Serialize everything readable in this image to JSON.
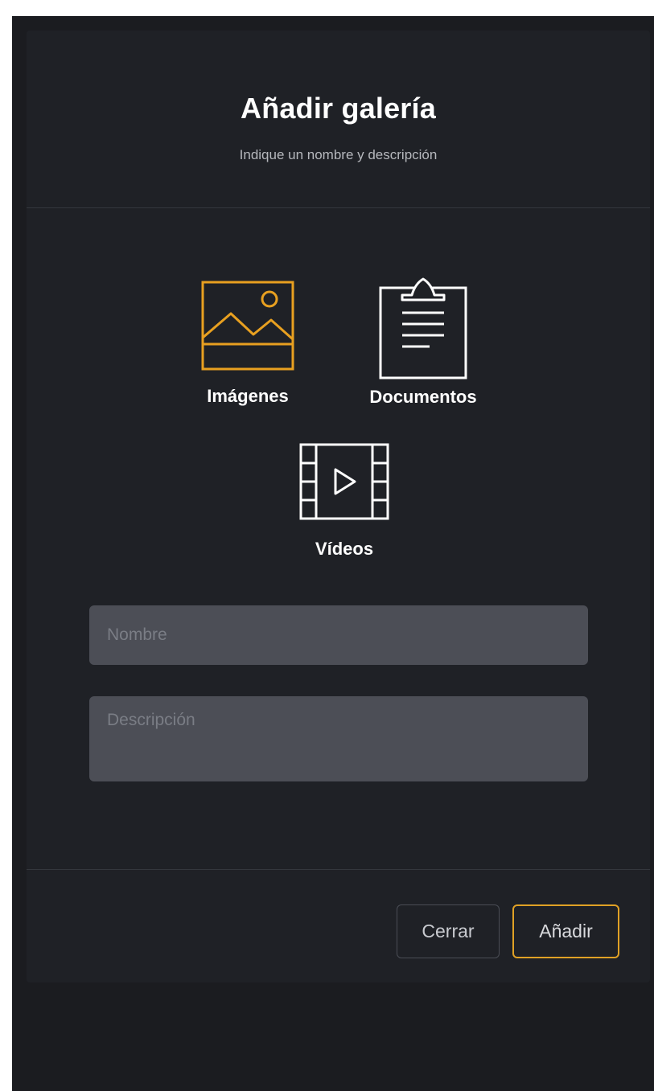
{
  "modal": {
    "title": "Añadir galería",
    "subtitle": "Indique un nombre y descripción"
  },
  "gallery_types": {
    "images": {
      "label": "Imágenes",
      "icon": "image-icon",
      "selected": true
    },
    "documents": {
      "label": "Documentos",
      "icon": "clipboard-document-icon",
      "selected": false
    },
    "videos": {
      "label": "Vídeos",
      "icon": "film-play-icon",
      "selected": false
    }
  },
  "form": {
    "name": {
      "placeholder": "Nombre",
      "value": ""
    },
    "description": {
      "placeholder": "Descripción",
      "value": ""
    }
  },
  "footer": {
    "close_label": "Cerrar",
    "add_label": "Añadir"
  },
  "colors": {
    "accent": "#e8a020",
    "background": "#1f2126",
    "field": "#4c4e56"
  }
}
